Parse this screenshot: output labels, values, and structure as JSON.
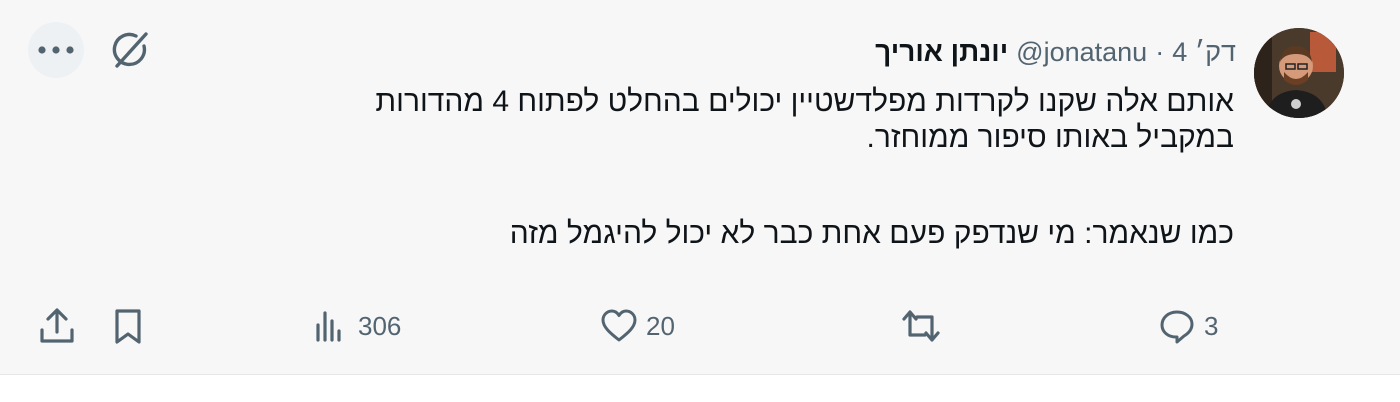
{
  "author": {
    "name": "יונתן אוריך",
    "handle": "@jonatanu",
    "separator": "·",
    "time": "דק׳ 4"
  },
  "tweet": {
    "line1": "אותם אלה שקנו לקרדות מפלדשטיין יכולים בהחלט לפתוח 4 מהדורות",
    "line2": "במקביל באותו סיפור ממוחזר.",
    "line3": "כמו שנאמר: מי שנדפק פעם אחת כבר לא יכול להיגמל מזה"
  },
  "metrics": {
    "replies": "3",
    "retweets": "",
    "likes": "20",
    "views": "306"
  },
  "icons": {
    "top": [
      "grok-icon",
      "more-icon"
    ],
    "actions": [
      "reply-icon",
      "retweet-icon",
      "like-icon",
      "views-icon",
      "bookmark-icon",
      "share-icon"
    ]
  },
  "colors": {
    "background": "#f7f7f7",
    "text": "#0f1419",
    "muted": "#536471"
  }
}
